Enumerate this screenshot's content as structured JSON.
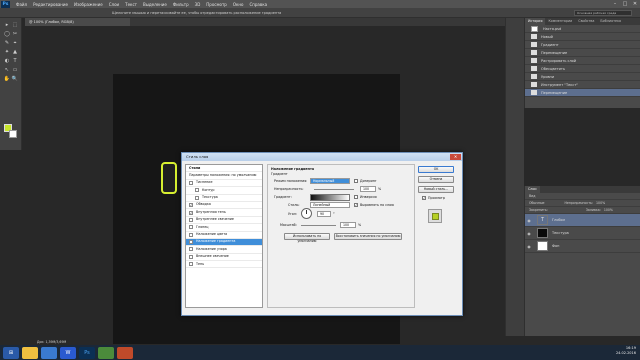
{
  "menubar": {
    "logo": "Ps",
    "items": [
      "Файл",
      "Редактирование",
      "Изображение",
      "Слои",
      "Текст",
      "Выделение",
      "Фильтр",
      "3D",
      "Просмотр",
      "Окно",
      "Справка"
    ]
  },
  "optionsbar": {
    "hint": "Щелкните мышью и перетаскивайте ее, чтобы отредактировать расположение градиента",
    "workspace": "Основная рабочая среда"
  },
  "document": {
    "tab": "@ 100% (Глобол, RGB/8)",
    "status": "Док: 1,39M/3,69M"
  },
  "history": {
    "tabs": [
      "История",
      "Комментарии",
      "Свойства",
      "Библиотека"
    ],
    "items": [
      {
        "label": "Настя.psd"
      },
      {
        "label": "Новый"
      },
      {
        "label": "Градиент"
      },
      {
        "label": "Перемещение"
      },
      {
        "label": "Растрировать слой"
      },
      {
        "label": "Обесцветить"
      },
      {
        "label": "Уровни"
      },
      {
        "label": "Инструмент \"Текст\""
      },
      {
        "label": "Перемещение"
      }
    ]
  },
  "layers": {
    "title": "Слои",
    "kind_label": "Вид",
    "blend": "Обычные",
    "opacity_label": "Непрозрачность:",
    "opacity": "100%",
    "lock_label": "Закрепить:",
    "fill_label": "Заливка:",
    "fill": "100%",
    "items": [
      {
        "name": "Глобол",
        "thumb": "T"
      },
      {
        "name": "Текстура",
        "thumb": ""
      },
      {
        "name": "Фон",
        "thumb": ""
      }
    ]
  },
  "dialog": {
    "title": "Стиль слоя",
    "styles_header": "Стили",
    "blend_options": "Параметры наложения: по умолчанию",
    "effects": [
      {
        "label": "Тиснение",
        "checked": false,
        "indent": false
      },
      {
        "label": "Контур",
        "checked": false,
        "indent": true
      },
      {
        "label": "Текстура",
        "checked": false,
        "indent": true
      },
      {
        "label": "Обводка",
        "checked": true,
        "indent": false
      },
      {
        "label": "Внутренняя тень",
        "checked": true,
        "indent": false
      },
      {
        "label": "Внутреннее свечение",
        "checked": false,
        "indent": false
      },
      {
        "label": "Глянец",
        "checked": false,
        "indent": false
      },
      {
        "label": "Наложение цвета",
        "checked": false,
        "indent": false
      },
      {
        "label": "Наложение градиента",
        "checked": true,
        "indent": false,
        "selected": true
      },
      {
        "label": "Наложение узора",
        "checked": false,
        "indent": false
      },
      {
        "label": "Внешнее свечение",
        "checked": false,
        "indent": false
      },
      {
        "label": "Тень",
        "checked": false,
        "indent": false
      }
    ],
    "section_title": "Наложение градиента",
    "subsection": "Градиент",
    "blend_mode_label": "Режим наложения:",
    "blend_mode_value": "Нормальный",
    "dither_label": "Дизеринг",
    "opacity_label": "Непрозрачность:",
    "opacity_value": "100",
    "gradient_label": "Градиент:",
    "reverse_label": "Инверсия",
    "style_label": "Стиль:",
    "style_value": "Линейный",
    "align_label": "Выровнять по слою",
    "angle_label": "Угол:",
    "angle_value": "90",
    "scale_label": "Масштаб:",
    "scale_value": "100",
    "percent": "%",
    "degrees": "°",
    "make_default": "Использовать по умолчанию",
    "reset_default": "Восстановить значения по умолчанию",
    "ok": "OK",
    "cancel": "Отмена",
    "new_style": "Новый стиль...",
    "preview_label": "Просмотр"
  },
  "taskbar": {
    "time": "16:19",
    "date": "24.02.2016"
  }
}
